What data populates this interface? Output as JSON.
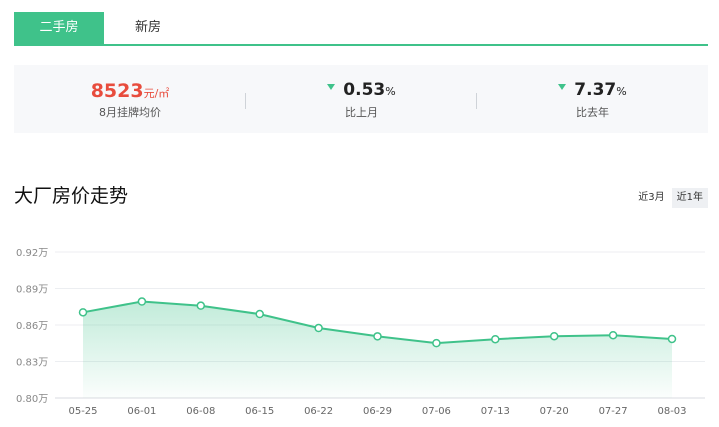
{
  "tabs": [
    {
      "label": "二手房",
      "active": true
    },
    {
      "label": "新房",
      "active": false
    }
  ],
  "stats": {
    "price": {
      "value": "8523",
      "unit": "元/㎡",
      "label": "8月挂牌均价"
    },
    "mom": {
      "value": "0.53",
      "unit": "%",
      "label": "比上月",
      "direction": "down"
    },
    "yoy": {
      "value": "7.37",
      "unit": "%",
      "label": "比去年",
      "direction": "down"
    }
  },
  "section": {
    "title": "大厂房价走势",
    "range_options": [
      {
        "label": "近3月",
        "active": false
      },
      {
        "label": "近1年",
        "active": true
      }
    ]
  },
  "colors": {
    "accent": "#3fc28a",
    "price": "#e84c3d"
  },
  "chart_data": {
    "type": "area",
    "categories": [
      "05-25",
      "06-01",
      "06-08",
      "06-15",
      "06-22",
      "06-29",
      "07-06",
      "07-13",
      "07-20",
      "07-27",
      "08-03"
    ],
    "values": [
      0.8704,
      0.8793,
      0.8759,
      0.869,
      0.8575,
      0.8507,
      0.8451,
      0.8483,
      0.8508,
      0.8516,
      0.8485
    ],
    "ylim": [
      0.8,
      0.92
    ],
    "yticks": [
      0.8,
      0.83,
      0.86,
      0.89,
      0.92
    ],
    "ytick_labels": [
      "0.80万",
      "0.83万",
      "0.86万",
      "0.89万",
      "0.92万"
    ],
    "grid": true,
    "color": "#3fc28a"
  }
}
